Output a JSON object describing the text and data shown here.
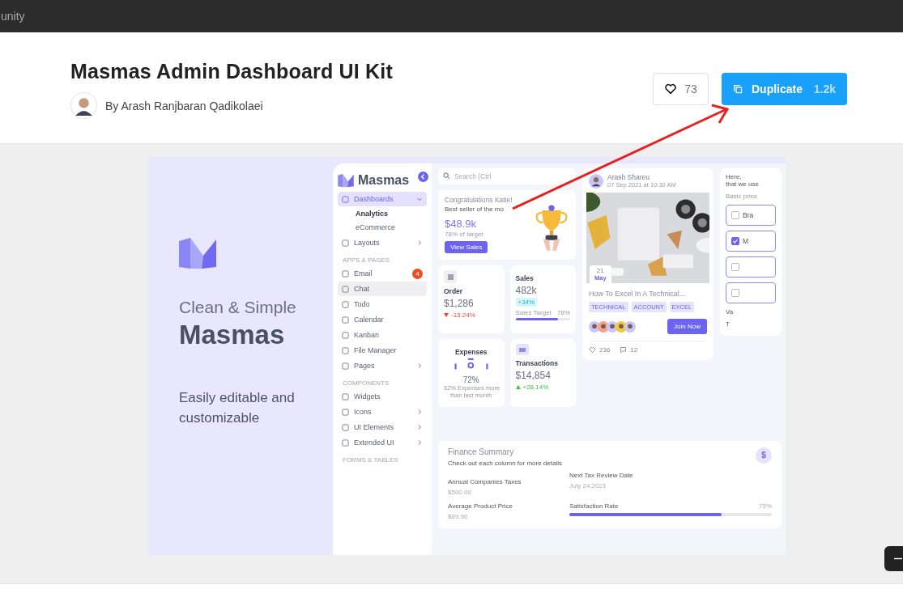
{
  "top_bar": {
    "text": "unity"
  },
  "header": {
    "title": "Masmas Admin Dashboard UI Kit",
    "author": "By Arash Ranjbaran Qadikolaei",
    "likes": "73",
    "duplicate_label": "Duplicate",
    "duplicate_count": "1.2k"
  },
  "preview": {
    "tagline": "Clean & Simple",
    "brand": "Masmas",
    "description": "Easily editable and customizable",
    "dashboard": {
      "logo": "Masmas",
      "search_placeholder": "Search (Ctrl",
      "sidebar": [
        {
          "kind": "item",
          "label": "Dashboards",
          "selected": true,
          "highlighted": false,
          "submenu": true,
          "expanded": true,
          "children": [
            {
              "label": "Analytics",
              "selected": true
            },
            {
              "label": "eCommerce",
              "selected": false
            }
          ]
        },
        {
          "kind": "item",
          "label": "Layouts",
          "selected": false,
          "highlighted": false,
          "submenu": true,
          "expanded": false
        },
        {
          "kind": "section",
          "label": "APPS & PAGES"
        },
        {
          "kind": "item",
          "label": "Email",
          "badge": "4",
          "selected": false,
          "highlighted": false,
          "submenu": false
        },
        {
          "kind": "item",
          "label": "Chat",
          "selected": false,
          "highlighted": true,
          "submenu": false
        },
        {
          "kind": "item",
          "label": "Todo",
          "selected": false,
          "highlighted": false,
          "submenu": false
        },
        {
          "kind": "item",
          "label": "Calendar",
          "selected": false,
          "highlighted": false,
          "submenu": false
        },
        {
          "kind": "item",
          "label": "Kanban",
          "selected": false,
          "highlighted": false,
          "submenu": false
        },
        {
          "kind": "item",
          "label": "File Manager",
          "selected": false,
          "highlighted": false,
          "submenu": false
        },
        {
          "kind": "item",
          "label": "Pages",
          "selected": false,
          "highlighted": false,
          "submenu": true,
          "expanded": false
        },
        {
          "kind": "section",
          "label": "COMPONENTS"
        },
        {
          "kind": "item",
          "label": "Widgets",
          "selected": false,
          "highlighted": false,
          "submenu": false
        },
        {
          "kind": "item",
          "label": "Icons",
          "selected": false,
          "highlighted": false,
          "submenu": true,
          "expanded": false
        },
        {
          "kind": "item",
          "label": "UI Elements",
          "selected": false,
          "highlighted": false,
          "submenu": true,
          "expanded": false
        },
        {
          "kind": "item",
          "label": "Extended UI",
          "selected": false,
          "highlighted": false,
          "submenu": true,
          "expanded": false
        },
        {
          "kind": "section",
          "label": "FORMS & TABLES"
        }
      ],
      "welcome": {
        "title": "Congratulations Katie!",
        "subtitle": "Best seller of the mo",
        "amount": "$48.9k",
        "note": "78% of target",
        "button": "View Sales"
      },
      "order": {
        "title": "Order",
        "value": "$1,286",
        "change": "-13.24%",
        "negative": true
      },
      "sales": {
        "title": "Sales",
        "value": "482k",
        "badge": "+34%",
        "target_label": "Sales Target",
        "target": "78%",
        "level": 0.78
      },
      "expenses": {
        "title": "Expenses",
        "value": "72%",
        "note": "52% Expenses more",
        "note2": "than last month"
      },
      "transactions": {
        "title": "Transactions",
        "value": "$14,854",
        "change": "+28.14%",
        "negative": false
      },
      "post": {
        "author": "Arash Shareu",
        "date": "07 Sep 2021 at 10:30 AM",
        "day": "21",
        "month": "May",
        "title": "How To Excel In A Technical...",
        "tags": [
          "TECHNICAL",
          "ACCOUNT",
          "EXCEL"
        ],
        "button": "Join Now",
        "likes": "236",
        "comments": "12"
      },
      "finance": {
        "title": "Finance Summary",
        "subtitle": "Check out each column for more details",
        "badge": "$",
        "items": [
          {
            "label": "Annual Companies Taxes",
            "value": "$500.00"
          },
          {
            "label": "Next Tax Review Date",
            "value": "July 24,2021"
          },
          {
            "label": "Average Product Price",
            "value": "$89.90"
          }
        ],
        "rate_label": "Satisfaction Rate",
        "rate": "75%",
        "level": 0.75
      },
      "pricing": {
        "line1": "Here,",
        "line2": "that we use",
        "label": "Basic price",
        "options": [
          {
            "label": "Bra",
            "checked": false
          },
          {
            "label": "M",
            "checked": true
          },
          {
            "checked": false
          },
          {
            "checked": false
          }
        ],
        "extra": [
          "Va",
          "T"
        ]
      }
    }
  }
}
